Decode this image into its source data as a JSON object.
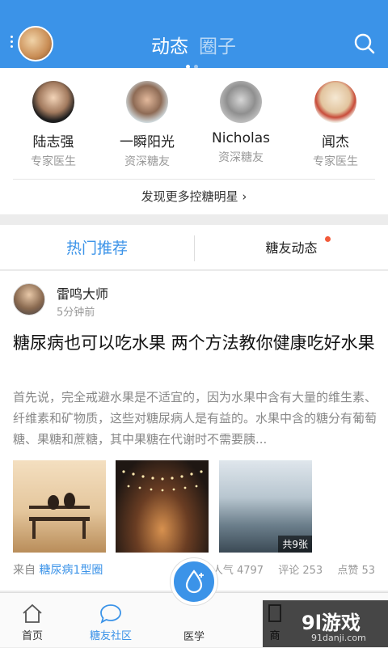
{
  "header": {
    "tab_active": "动态",
    "tab_inactive": "圈子",
    "search_icon": "search-icon",
    "accent": "#3b93e8"
  },
  "stars": [
    {
      "name": "陆志强",
      "role": "专家医生"
    },
    {
      "name": "一瞬阳光",
      "role": "资深糖友"
    },
    {
      "name": "Nicholas",
      "role": "资深糖友"
    },
    {
      "name": "闻杰",
      "role": "专家医生"
    }
  ],
  "discover_label": "发现更多控糖明星 ›",
  "feed_tabs": {
    "hot": "热门推荐",
    "friends": "糖友动态"
  },
  "post": {
    "author": "雷鸣大师",
    "time": "5分钟前",
    "title": "糖尿病也可以吃水果 两个方法教你健康吃好水果",
    "body": "首先说，完全戒避水果是不适宜的，因为水果中含有大量的维生素、纤维素和矿物质，这些对糖尿病人是有益的。水果中含的糖分有葡萄糖、果糖和蔗糖，其中果糖在代谢时不需要胰...",
    "image_count": "共9张",
    "from_label": "来自",
    "from_circle": "糖尿病1型圈",
    "popularity": "人气 4797",
    "comments": "评论 253",
    "likes": "点赞 53"
  },
  "tabbar": {
    "home": "首页",
    "community": "糖友社区",
    "medicine": "医学",
    "fourth": "商"
  },
  "watermark": {
    "logo": "9l游戏",
    "url": "91danji.com"
  }
}
